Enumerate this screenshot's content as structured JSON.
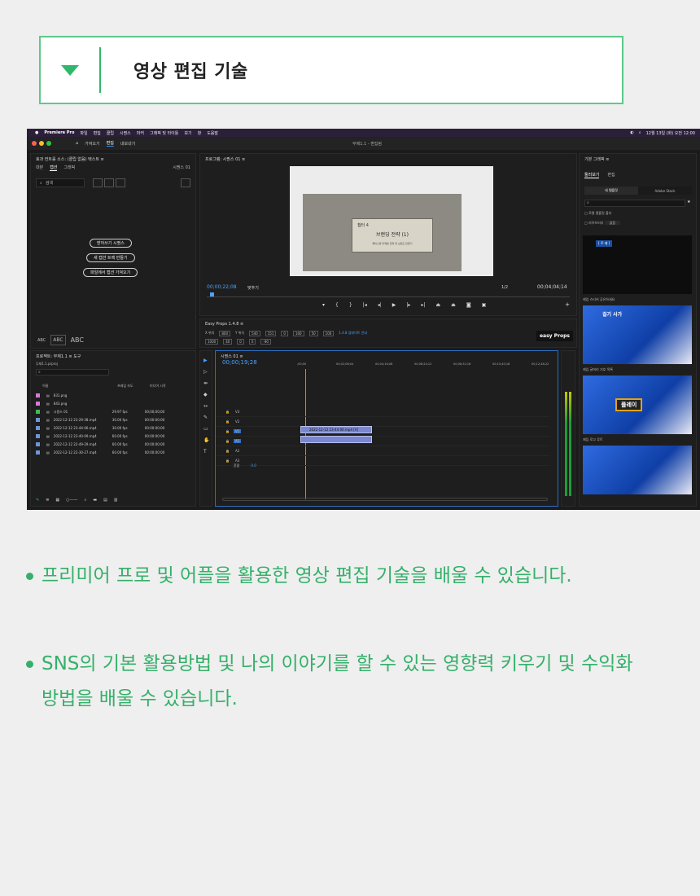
{
  "accordion": {
    "title": "영상 편집 기술"
  },
  "colors": {
    "accent": "#35b06a",
    "border": "#5cc98a"
  },
  "app": {
    "menubar": {
      "apple": "",
      "brand": "Premiere Pro",
      "items": [
        "파일",
        "편집",
        "클립",
        "시퀀스",
        "마커",
        "그래픽 및 타이틀",
        "보기",
        "창",
        "도움말"
      ],
      "datetime": "12월 13일 (화) 오전 12:00"
    },
    "titlebar": {
      "workspaces": [
        "가져오기",
        "편집",
        "내보내기"
      ],
      "document": "무제1.1 - 편집됨"
    },
    "left_panel": {
      "tabs": "효과 컨트롤   소스: (클립 없음)   텍스트  ≡",
      "subtabs": [
        "대본",
        "캡션",
        "그래픽"
      ],
      "sequence": "시퀀스 01",
      "search_placeholder": "검색",
      "buttons": [
        "받아쓰기 시퀀스",
        "새 캡션 트랙 만들기",
        "파일에서 캡션 가져오기"
      ],
      "abc": [
        "ABC",
        "ABC",
        "ABC"
      ]
    },
    "program_monitor": {
      "tab": "프로그램: 시퀀스 01  ≡",
      "card_heading": "챕터 4",
      "card_title": "브랜딩 전략 (1)",
      "card_sub": "페이스북 마케팅 전략 및 브랜드 만들기",
      "timecode": "00;00;22;08",
      "fit": "맞추기",
      "quality": "1/2",
      "duration": "00;04;04;14"
    },
    "easy_props": {
      "tab": "Easy Props 1.4.8  ≡",
      "version": "1.4.8 업데이트 안내",
      "brand": "easy Props",
      "fields": [
        "X 위치",
        "800",
        "Y 위치",
        "540",
        "151",
        "0",
        "100",
        "50",
        "100",
        "1000",
        "40",
        "0",
        "0",
        "-90"
      ]
    },
    "project": {
      "tab": "프로젝트: 무제1.1  ≡   도구",
      "file": "무제1.1.prproj",
      "columns": [
        "이름",
        "프레임 속도",
        "미디어 시작"
      ],
      "rows": [
        {
          "name": "831.png",
          "fps": "",
          "start": "",
          "color": "#d57bd4"
        },
        {
          "name": "843.png",
          "fps": "",
          "start": "",
          "color": "#d57bd4"
        },
        {
          "name": "시퀀스 01",
          "fps": "29.97 fps",
          "start": "00;00;00;00",
          "color": "#3bbd5a"
        },
        {
          "name": "2022-12-12 23-29-38.mp4",
          "fps": "30.00 fps",
          "start": "00:00:00:00",
          "color": "#6e95d6"
        },
        {
          "name": "2022-12-12 23-44-06.mp4",
          "fps": "30.00 fps",
          "start": "00:00:00:00",
          "color": "#6e95d6"
        },
        {
          "name": "2022-12-12 23-40-09.mp4",
          "fps": "60.00 fps",
          "start": "00:00:00:00",
          "color": "#6e95d6"
        },
        {
          "name": "2022-12-12 22-49-29.mp4",
          "fps": "60.00 fps",
          "start": "00:00:00:00",
          "color": "#6e95d6"
        },
        {
          "name": "2022-12-12 22-30-27.mp4",
          "fps": "60.00 fps",
          "start": "00:00:00:00",
          "color": "#6e95d6"
        }
      ]
    },
    "timeline": {
      "tab": "시퀀스 01  ≡",
      "timecode": "00;00;19;28",
      "ruler": [
        ";00;00",
        "00;02;08;04",
        "00;04;16;08",
        "00;06;24;12",
        "00;08;32;16",
        "00;10;40;18",
        "00;12;48;22"
      ],
      "tracks": [
        "V3",
        "V2",
        "V1",
        "A1",
        "A2",
        "A3"
      ],
      "mix": "혼합",
      "mix_value": "0.0",
      "clip_label": "2022-12-12 23-44-06.mp4 [V]"
    },
    "essential_graphics": {
      "tab": "기본 그래픽  ≡",
      "subtabs": [
        "둘러보기",
        "편집"
      ],
      "buttons": [
        "내 템플릿",
        "Adobe Stock"
      ],
      "checks": [
        "로컬 템플릿 폴더",
        "라이브러리"
      ],
      "library_value": "없음",
      "thumbs": [
        {
          "label": "제임 스티커 공유하세요",
          "text": "[ 주 제 ]"
        },
        {
          "label": "제임 글머리 기호 목록",
          "text": "걸기 사가"
        },
        {
          "label": "제임 로고 루트",
          "text": "플레이"
        }
      ]
    }
  },
  "bullets": [
    "프리미어 프로 및 어플을 활용한 영상 편집 기술을 배울 수 있습니다.",
    "SNS의 기본 활용방법 및 나의 이야기를 할 수 있는 영향력 키우기 및 수익화 방법을 배울 수 있습니다."
  ]
}
